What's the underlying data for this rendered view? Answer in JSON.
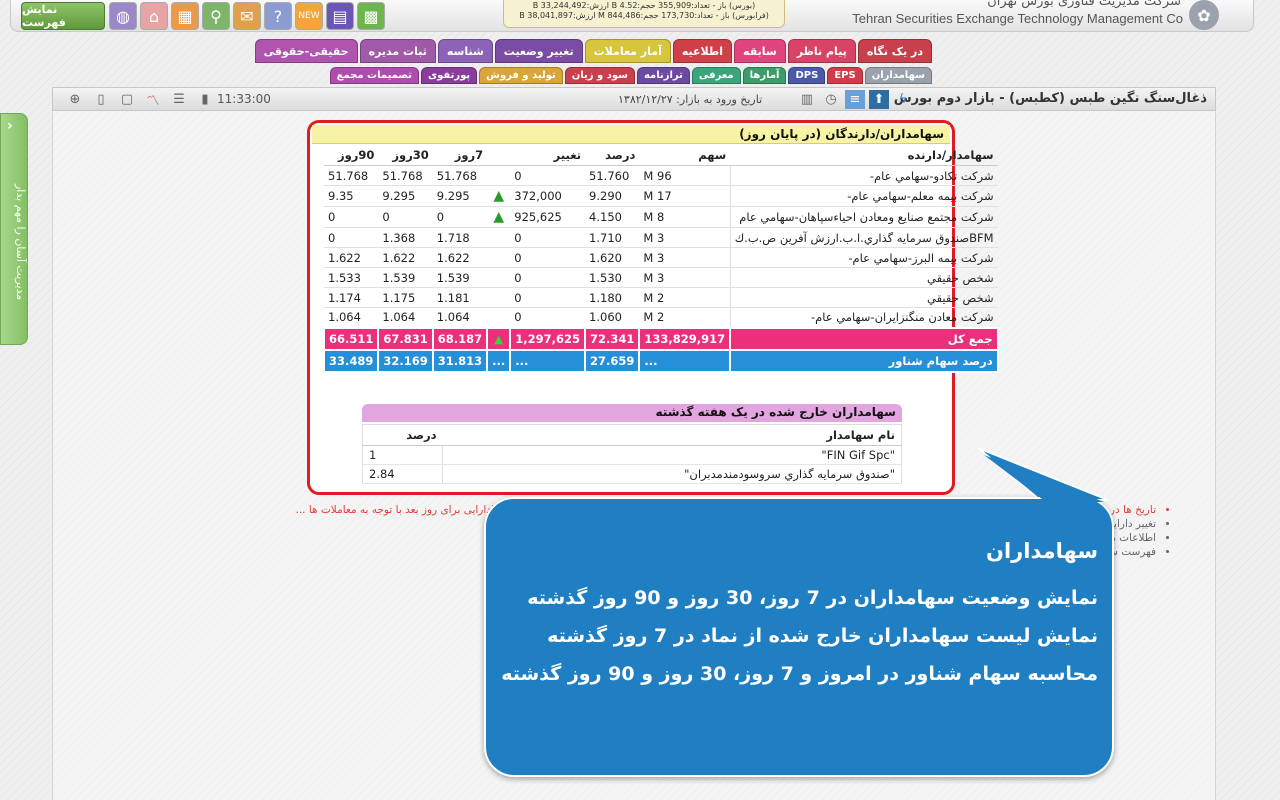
{
  "header": {
    "menu_label": "نمایش فهرست",
    "company_fa": "شرکت مدیریت فناوری بورس تهران",
    "company_en": "Tehran Securities Exchange Technology Management Co",
    "ticker_line1": "(بورس) باز - تعداد:355,909 حجم:4.52 B ارزش:33,244,492 B",
    "ticker_line2": "(فرابورس) باز - تعداد:173,730 حجم:844,486 M ارزش:38,041,897 B",
    "tool_icons": [
      "grid-icon",
      "chart-icon",
      "new-badge-icon",
      "help-icon",
      "chat-icon",
      "search-icon",
      "calculator-icon",
      "home-icon",
      "globe-icon"
    ]
  },
  "tabs_row1": [
    {
      "label": "در یک نگاه",
      "color": "#c8404b"
    },
    {
      "label": "پیام ناظر",
      "color": "#d94466"
    },
    {
      "label": "سابقه",
      "color": "#e0447d"
    },
    {
      "label": "اطلاعیه",
      "color": "#d0404a"
    },
    {
      "label": "آمار معاملات",
      "color": "#d7c53e"
    },
    {
      "label": "تغییر وضعیت",
      "color": "#7a4ca3"
    },
    {
      "label": "شناسه",
      "color": "#8d63b8"
    },
    {
      "label": "ثبات مدیره",
      "color": "#a15aa8"
    },
    {
      "label": "حقیقی-حقوقی",
      "color": "#b054b0"
    }
  ],
  "tabs_row2": [
    {
      "label": "سهامداران",
      "color": "#9aa3ab"
    },
    {
      "label": "EPS",
      "color": "#d03c4a"
    },
    {
      "label": "DPS",
      "color": "#4a5aa8"
    },
    {
      "label": "آمارها",
      "color": "#3c9d6a"
    },
    {
      "label": "معرفی",
      "color": "#3aa67a"
    },
    {
      "label": "ترازنامه",
      "color": "#6c4aa3"
    },
    {
      "label": "سود و زیان",
      "color": "#c8404b"
    },
    {
      "label": "تولید و فروش",
      "color": "#d9a63a"
    },
    {
      "label": "پورتفوی",
      "color": "#8a3c9d"
    },
    {
      "label": "تصمیمات مجمع",
      "color": "#b04cb0"
    }
  ],
  "titlebar": {
    "title": "ذغال‌سنگ نگین طبس (کطبس) - بازار دوم بورس",
    "entry_date": "تاریخ ورود به بازار: ۱۳۸۲/۱۲/۲۷",
    "clock": "11:33:00"
  },
  "sidetab": {
    "label": "مدیریت آسان را مهم بدار"
  },
  "shareholders": {
    "title": "سهامداران/دارندگان (در پایان روز)",
    "columns": [
      "سهامدار/دارنده",
      "سهم",
      "درصد",
      "تغییر",
      "",
      "7روز",
      "30روز",
      "90روز"
    ],
    "rows": [
      {
        "name": "شرکت تکادو-سهامي عام-",
        "shares": "96 M",
        "pct": "51.760",
        "change": "0",
        "arrow": "",
        "d7": "51.768",
        "d30": "51.768",
        "d90": "51.768"
      },
      {
        "name": "شرکت بيمه معلم-سهامي عام-",
        "shares": "17 M",
        "pct": "9.290",
        "change": "372,000",
        "arrow": "▲",
        "d7": "9.295",
        "d30": "9.295",
        "d90": "9.35"
      },
      {
        "name": "شرکت مجتمع صنايع ومعادن احياءسپاهان-سهامي عام",
        "shares": "8 M",
        "pct": "4.150",
        "change": "925,625",
        "arrow": "▲",
        "d7": "0",
        "d30": "0",
        "d90": "0"
      },
      {
        "name": "BFMصندوق سرمايه گذاري.ا.ب.ارزش آفرين ص.ب.ك",
        "shares": "3 M",
        "pct": "1.710",
        "change": "0",
        "arrow": "",
        "d7": "1.718",
        "d30": "1.368",
        "d90": "0"
      },
      {
        "name": "شرکت بيمه البرز-سهامي عام-",
        "shares": "3 M",
        "pct": "1.620",
        "change": "0",
        "arrow": "",
        "d7": "1.622",
        "d30": "1.622",
        "d90": "1.622"
      },
      {
        "name": "شخص حقيقي",
        "shares": "3 M",
        "pct": "1.530",
        "change": "0",
        "arrow": "",
        "d7": "1.539",
        "d30": "1.539",
        "d90": "1.533"
      },
      {
        "name": "شخص حقيقي",
        "shares": "2 M",
        "pct": "1.180",
        "change": "0",
        "arrow": "",
        "d7": "1.181",
        "d30": "1.175",
        "d90": "1.174"
      },
      {
        "name": "شرکت معادن منگنزايران-سهامي عام-",
        "shares": "2 M",
        "pct": "1.060",
        "change": "0",
        "arrow": "",
        "d7": "1.064",
        "d30": "1.064",
        "d90": "1.064"
      }
    ],
    "total": {
      "label": "جمع کل",
      "shares": "133,829,917",
      "pct": "72.341",
      "change": "1,297,625",
      "arrow": "▲",
      "d7": "68.187",
      "d30": "67.831",
      "d90": "66.511"
    },
    "float": {
      "label": "درصد سهام شناور",
      "shares": "...",
      "pct": "27.659",
      "change": "...",
      "arrow": "...",
      "d7": "31.813",
      "d30": "32.169",
      "d90": "33.489"
    }
  },
  "exited": {
    "title": "سهامداران خارج شده در یک هفته گذشته",
    "col_name": "نام سهامدار",
    "col_pct": "درصد",
    "rows": [
      {
        "name": "\"FIN Gif Spc\"",
        "pct": "1"
      },
      {
        "name": "\"صندوق سرمايه گذاري سروسودمندمدبران\"",
        "pct": "2.84"
      }
    ]
  },
  "notes": [
    "تاریخ ها در ... معاملاتی بعد از روز معاملاتی می باشد. برای مثال در پایان روز 1393/4/15 اطلاعات سهامداران عمده دارای تاریخ 1393/4/16 می باشد (دارایی برای روز بعد با توجه به معاملات ها ...",
    "تغییر دارایی ...",
    "اطلاعات ها ... سهام است و در بر دارنده معاملات و نقل و انتقالات روز جاری معاملاتی نیست، تغییر دارایی سهامداران ... در سایت منتشر می شود.",
    "فهرست س... لازم برخوردار نباشد، بنابراین اگر به چنین اطلاعاتی نیاز است باید پس از طی تشریفات ق... به عمل آید."
  ],
  "callout": {
    "title": "سهامداران",
    "lines": [
      "نمایش وضعیت سهامداران در 7 روز، 30 روز و 90 روز گذشته",
      "نمایش لیست سهامداران خارج شده از نماد در 7 روز گذشته",
      "محاسبه سهام شناور در امروز و 7 روز، 30 روز و 90 روز گذشته"
    ]
  }
}
